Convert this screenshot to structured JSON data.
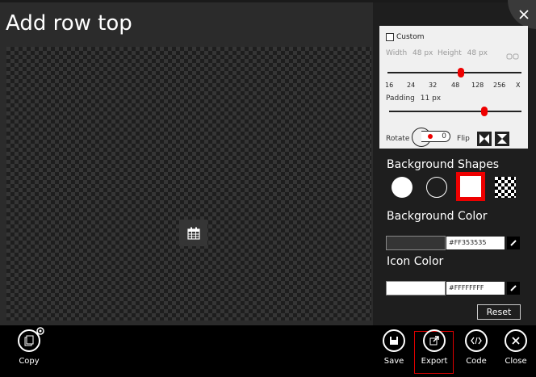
{
  "page": {
    "title": "Add row top"
  },
  "settings": {
    "custom_label": "Custom",
    "width_label": "Width",
    "width_value": "48 px",
    "height_label": "Height",
    "height_value": "48 px",
    "size_ticks": [
      "16",
      "24",
      "32",
      "48",
      "128",
      "256",
      "X"
    ],
    "size_level": 0.55,
    "padding_label": "Padding",
    "padding_value": "11 px",
    "padding_level": 0.72,
    "rotate_label": "Rotate",
    "rotate_value": "0",
    "flip_label": "Flip"
  },
  "background_shapes": {
    "title": "Background Shapes",
    "selected": "square"
  },
  "background_color": {
    "title": "Background Color",
    "hex": "#FF353535",
    "swatch": "#353535"
  },
  "icon_color": {
    "title": "Icon Color",
    "hex": "#FFFFFFFF",
    "swatch": "#ffffff"
  },
  "reset_label": "Reset",
  "bottom_bar": {
    "copy": "Copy",
    "save": "Save",
    "export": "Export",
    "code": "Code",
    "close": "Close"
  },
  "colors": {
    "accent": "#e00000",
    "panel": "#1e1e1e"
  }
}
